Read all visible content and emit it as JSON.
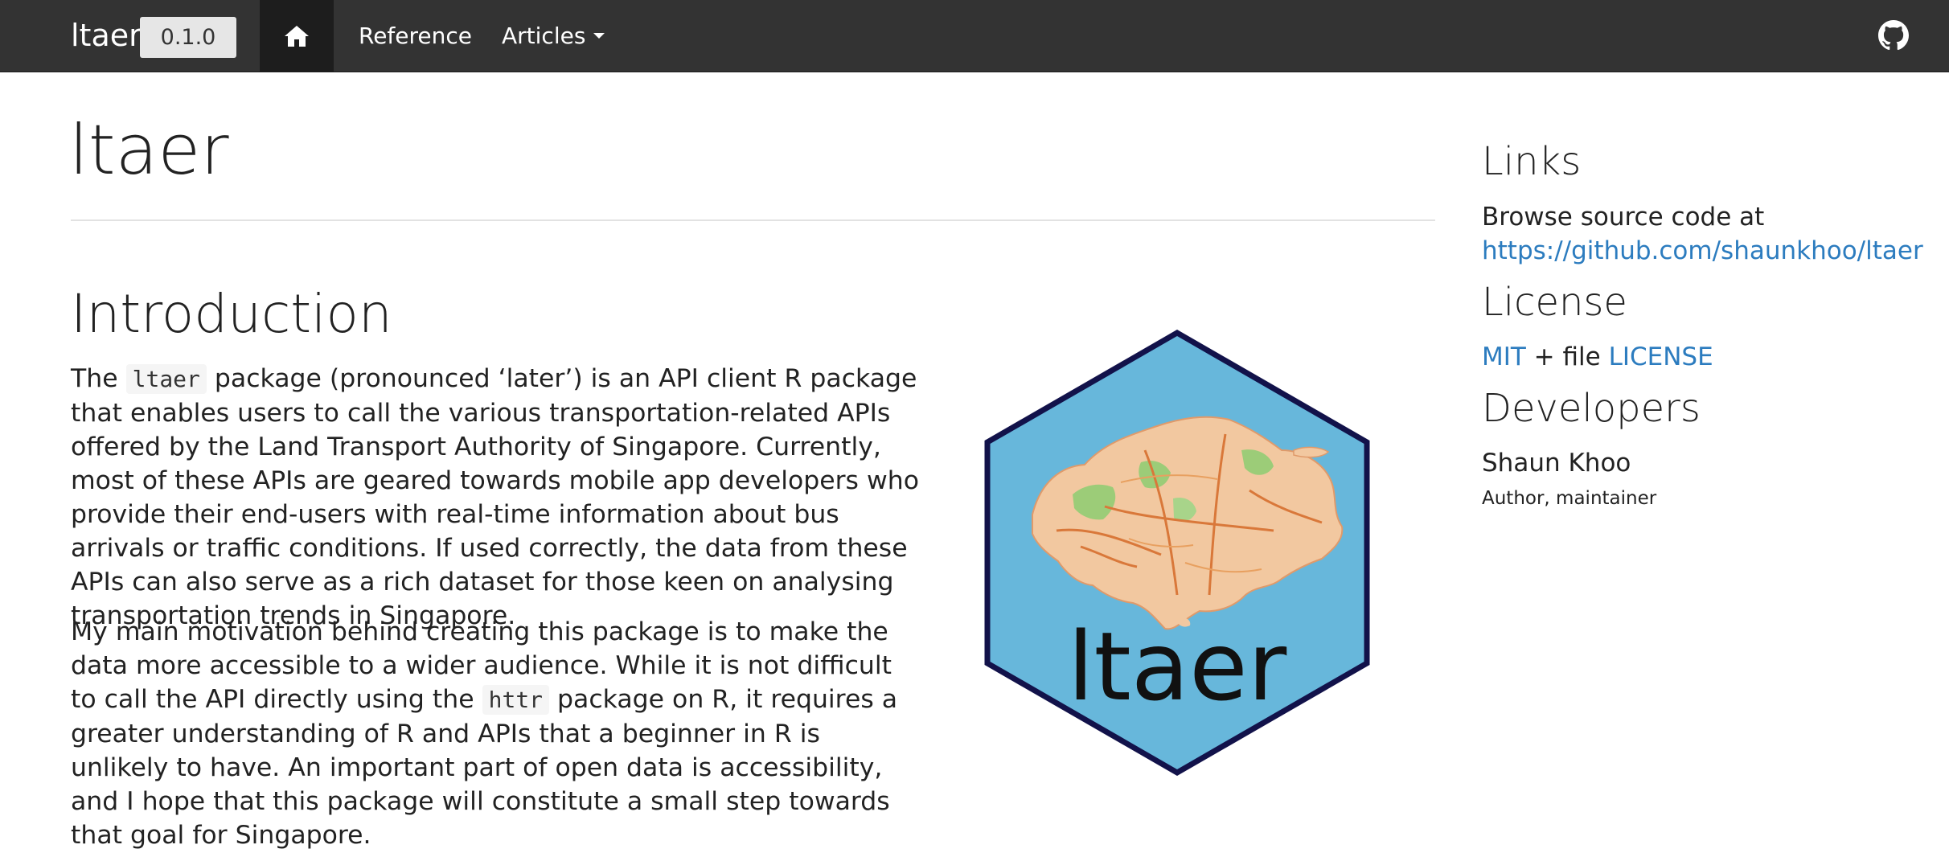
{
  "navbar": {
    "brand": "ltaer",
    "version": "0.1.0",
    "home_icon": "home-icon",
    "items": [
      {
        "label": "Reference"
      },
      {
        "label": "Articles"
      }
    ],
    "github_icon": "github-icon"
  },
  "main": {
    "title": "ltaer",
    "intro_heading": "Introduction",
    "para1": {
      "before": "The ",
      "code": "ltaer",
      "after": " package (pronounced ‘later’) is an API client R package that enables users to call the various transportation-related APIs offered by the Land Transport Authority of Singapore. Currently, most of these APIs are geared towards mobile app developers who provide their end-users with real-time information about bus arrivals or traffic conditions. If used correctly, the data from these APIs can also serve as a rich dataset for those keen on analysing transportation trends in Singapore."
    },
    "para2": {
      "before": "My main motivation behind creating this package is to make the data more accessible to a wider audience. While it is not difficult to call the API directly using the ",
      "code": "httr",
      "after": " package on R, it requires a greater understanding of R and APIs that a beginner in R is unlikely to have. An important part of open data is accessibility, and I hope that this package will constitute a small step towards that goal for Singapore."
    },
    "logo_text": "ltaer"
  },
  "sidebar": {
    "links_heading": "Links",
    "browse_text": "Browse source code at",
    "repo_url": "https://github.com/shaunkhoo/ltaer",
    "license_heading": "License",
    "license_mit": "MIT",
    "license_mid": " + file ",
    "license_file": "LICENSE",
    "developers_heading": "Developers",
    "dev_name": "Shaun Khoo",
    "dev_role": "Author, maintainer"
  },
  "colors": {
    "navbar_bg": "#333333",
    "link": "#2c7cbf",
    "hex_fill": "#67b7db",
    "hex_border": "#12124a"
  }
}
